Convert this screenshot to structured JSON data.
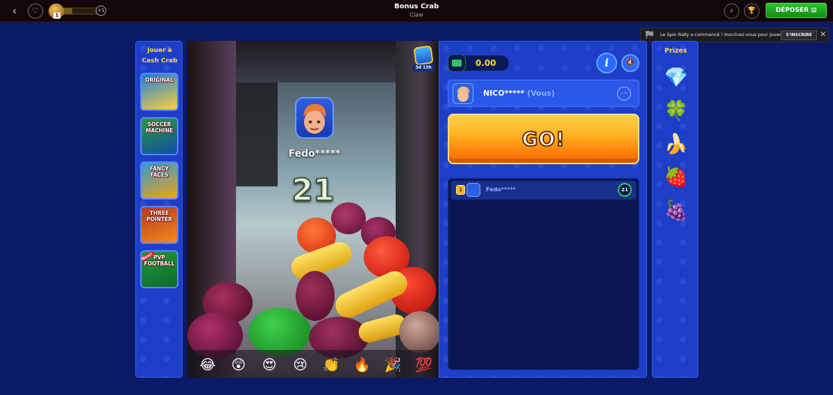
{
  "topbar": {
    "back_icon": "chevron-left-icon",
    "favorite_icon": "heart-icon",
    "level": "1",
    "level_progress": 0.25,
    "level_plus": "+1",
    "title": "Bonus Crab",
    "subtitle": "Claw",
    "search_icon": "search-icon",
    "trophy_icon": "trophy-icon",
    "deposit_label": "DÉPOSER"
  },
  "notification": {
    "text": "Le Spin Rally a commencé ! Inscrivez-vous pour jouer",
    "button_label": "S'INSCRIRE"
  },
  "left_panel": {
    "title_line1": "Jouer à",
    "title_line2": "Cash Crab",
    "games": [
      {
        "label": "ORIGINAL",
        "colors": [
          "#1e7bdc",
          "#fbd23a"
        ]
      },
      {
        "label": "SOCCER MACHINE",
        "colors": [
          "#2a9a3a",
          "#0f4fa8"
        ]
      },
      {
        "label": "FANCY FACES",
        "colors": [
          "#2f9ad0",
          "#f1a21a"
        ]
      },
      {
        "label": "THREE POINTER",
        "colors": [
          "#b33a20",
          "#f28a1a"
        ]
      },
      {
        "label": "PVP FOOTBALL",
        "colors": [
          "#1f9a3a",
          "#0e6a2a"
        ],
        "tag": "New!"
      }
    ]
  },
  "camera": {
    "player_name": "Fedo*****",
    "countdown": "21",
    "timer_label": "3d 13h",
    "emojis": [
      "😂",
      "😲",
      "😍",
      "😢",
      "👏",
      "🔥",
      "🎉",
      "💯"
    ]
  },
  "control": {
    "balance": "0.00",
    "info_label": "i",
    "mute_icon": "mute-icon",
    "user_name": "NICO*****",
    "user_you": "(Vous)",
    "more_label": "···",
    "go_label": "GO!",
    "queue": [
      {
        "rank": "1",
        "name": "Fedo*****",
        "count": "21"
      }
    ]
  },
  "prizes": {
    "title": "Prizes",
    "items": [
      {
        "icon": "💎",
        "name": "diamond-icon"
      },
      {
        "icon": "🍀",
        "name": "clover-icon"
      },
      {
        "icon": "🍌",
        "name": "banana-icon"
      },
      {
        "icon": "🍓",
        "name": "strawberry-icon"
      },
      {
        "icon": "🍇",
        "name": "plum-icon"
      }
    ]
  },
  "colors": {
    "background": "#0b1a66",
    "panel": "#1d3fc8",
    "accent_yellow": "#ffd84a",
    "deposit_green": "#2fc22f",
    "go_orange": "#ff8a10"
  }
}
